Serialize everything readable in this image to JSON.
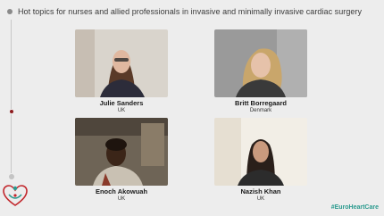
{
  "header": {
    "title": "Hot topics for nurses and allied professionals in invasive and minimally invasive cardiac surgery"
  },
  "participants": [
    {
      "name": "Julie Sanders",
      "country": "UK"
    },
    {
      "name": "Britt Borregaard",
      "country": "Denmark"
    },
    {
      "name": "Enoch Akowuah",
      "country": "UK"
    },
    {
      "name": "Nazish Khan",
      "country": "UK"
    }
  ],
  "footer": {
    "hashtag": "#EuroHeartCare"
  },
  "colors": {
    "accent": "#2a9a8e",
    "brand_red": "#c2282d",
    "background": "#ededed"
  }
}
